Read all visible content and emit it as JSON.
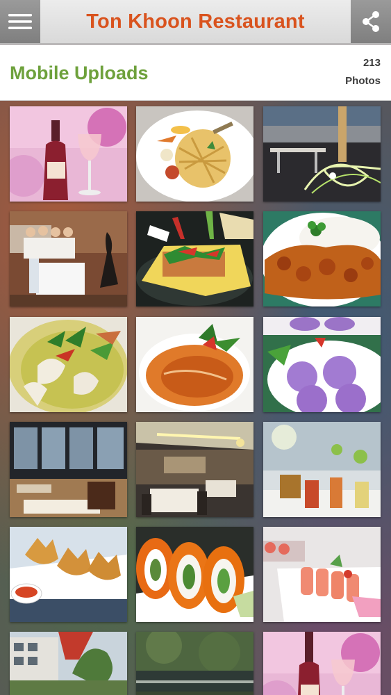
{
  "header": {
    "title": "Ton Khoon Restaurant",
    "menu_icon": "hamburger-menu-icon",
    "share_icon": "share-icon"
  },
  "album": {
    "name": "Mobile Uploads",
    "count": "213",
    "count_label": "Photos"
  },
  "photos": [
    {
      "subject": "wine bottle and glass"
    },
    {
      "subject": "pad thai plate"
    },
    {
      "subject": "riverside terrace at night"
    },
    {
      "subject": "staff in lobby"
    },
    {
      "subject": "omelette wrapped dish"
    },
    {
      "subject": "curry with rice"
    },
    {
      "subject": "green curry with basil"
    },
    {
      "subject": "red curry soup"
    },
    {
      "subject": "purple flower dumplings"
    },
    {
      "subject": "dining room windows"
    },
    {
      "subject": "restaurant interior"
    },
    {
      "subject": "cocktails on bar"
    },
    {
      "subject": "fried wontons with sauce"
    },
    {
      "subject": "sushi rolls with roe"
    },
    {
      "subject": "salmon sushi plate"
    },
    {
      "subject": "building exterior"
    },
    {
      "subject": "garden pond"
    },
    {
      "subject": "wine bottle and glass"
    }
  ]
}
